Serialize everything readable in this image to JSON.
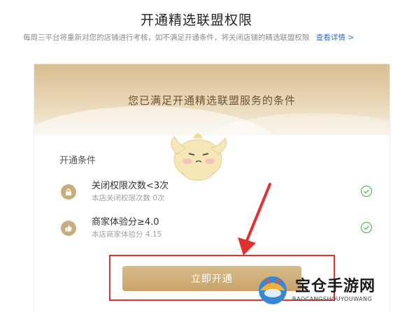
{
  "page": {
    "title": "开通精选联盟权限",
    "notice": "每周三平台将重新对您的店铺进行考核，如不满足开通条件，将关闭店铺的精选联盟权限",
    "details_link": "查看详情",
    "details_chevron": ">"
  },
  "card": {
    "banner_text": "您已满足开通精选联盟服务的条件",
    "conditions_heading": "开通条件",
    "conditions": [
      {
        "name": "关闭权限次数<3次",
        "subtitle": "本店关闭权限次数 0次",
        "icon": "lock-icon",
        "met": true
      },
      {
        "name": "商家体验分≥4.0",
        "subtitle": "本店商家体验分 4.15",
        "icon": "thumbs-up-icon",
        "met": true
      }
    ],
    "open_button": "立即开通"
  },
  "watermark": {
    "title": "宝仓手游网",
    "subtitle": "BAOCANGSHOUYOUWANG"
  },
  "colors": {
    "accent_gold": "#c7a36b",
    "link_blue": "#2f6fd6",
    "highlight_red": "#e0302f",
    "check_green": "#5cb85c"
  }
}
